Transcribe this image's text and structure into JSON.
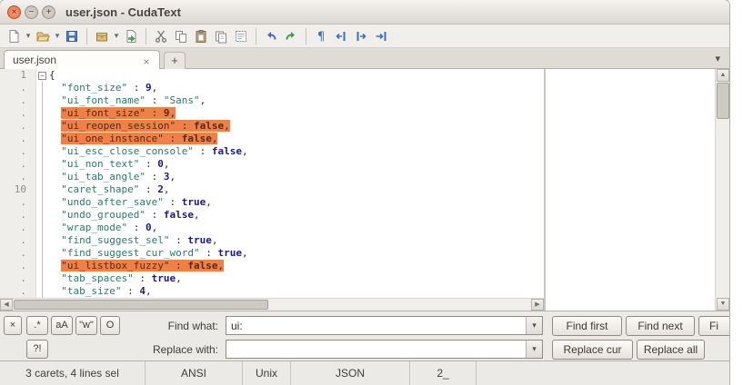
{
  "window": {
    "title": "user.json - CudaText"
  },
  "window_buttons": {
    "close": "×",
    "minimize": "−",
    "maximize": "+"
  },
  "toolbar": {
    "groups": [
      [
        {
          "name": "new-file",
          "dropdown": true
        },
        {
          "name": "open-file",
          "dropdown": true
        },
        {
          "name": "save",
          "dropdown": false
        }
      ],
      [
        {
          "name": "package",
          "dropdown": true
        },
        {
          "name": "reload-file",
          "dropdown": false
        }
      ],
      [
        {
          "name": "cut"
        },
        {
          "name": "copy"
        },
        {
          "name": "paste"
        },
        {
          "name": "duplicate"
        },
        {
          "name": "select-all"
        }
      ],
      [
        {
          "name": "undo"
        },
        {
          "name": "redo"
        }
      ],
      [
        {
          "name": "nonprint"
        },
        {
          "name": "unindent"
        },
        {
          "name": "indent"
        },
        {
          "name": "goto-end"
        }
      ]
    ]
  },
  "tabs": {
    "active_label": "user.json",
    "close_glyph": "×",
    "new_tab_glyph": "+",
    "list_dropdown_glyph": "▾"
  },
  "editor": {
    "lines": [
      {
        "gutter": "1",
        "text": "{",
        "selected": false
      },
      {
        "gutter": ".",
        "text": "  \"font_size\" : 9,",
        "selected": false
      },
      {
        "gutter": ".",
        "text": "  \"ui_font_name\" : \"Sans\",",
        "selected": false
      },
      {
        "gutter": ".",
        "text": "  \"ui_font_size\" : 9,",
        "selected": true
      },
      {
        "gutter": ".",
        "text": "  \"ui_reopen_session\" : false,",
        "selected": true
      },
      {
        "gutter": ".",
        "text": "  \"ui_one_instance\" : false,",
        "selected": true
      },
      {
        "gutter": ".",
        "text": "  \"ui_esc_close_console\" : false,",
        "selected": false
      },
      {
        "gutter": ".",
        "text": "  \"ui_non_text\" : 0,",
        "selected": false
      },
      {
        "gutter": ".",
        "text": "  \"ui_tab_angle\" : 3,",
        "selected": false
      },
      {
        "gutter": "10",
        "text": "  \"caret_shape\" : 2,",
        "selected": false
      },
      {
        "gutter": ".",
        "text": "  \"undo_after_save\" : true,",
        "selected": false
      },
      {
        "gutter": ".",
        "text": "  \"undo_grouped\" : false,",
        "selected": false
      },
      {
        "gutter": ".",
        "text": "  \"wrap_mode\" : 0,",
        "selected": false
      },
      {
        "gutter": ".",
        "text": "  \"find_suggest_sel\" : true,",
        "selected": false
      },
      {
        "gutter": ".",
        "text": "  \"find_suggest_cur_word\" : true,",
        "selected": false
      },
      {
        "gutter": ".",
        "text": "  \"ui_listbox_fuzzy\" : false,",
        "selected": true
      },
      {
        "gutter": ".",
        "text": "  \"tab_spaces\" : true,",
        "selected": false
      },
      {
        "gutter": ".",
        "text": "  \"tab_size\" : 4,",
        "selected": false
      }
    ],
    "fold_marker": "−"
  },
  "find_panel": {
    "close_label": "×",
    "toggles": {
      "regex": ".*",
      "case": "aA",
      "words": "\"w\"",
      "o": "O",
      "confirm": "?!"
    },
    "find_label": "Find what:",
    "find_value": "ui:",
    "replace_label": "Replace with:",
    "replace_value": "",
    "dropdown_glyph": "▾",
    "buttons": {
      "find_first": "Find first",
      "find_next": "Find next",
      "find_all_clipped": "Fi",
      "replace_cur": "Replace cur",
      "replace_all": "Replace all"
    }
  },
  "status_bar": {
    "items": [
      "3 carets, 4 lines sel",
      "ANSI",
      "Unix",
      "JSON",
      "2_"
    ]
  },
  "colors": {
    "selection": "#ee8048",
    "string": "#2a7a6e",
    "value": "#1a1a8c",
    "close_button": "#e66a3e"
  }
}
